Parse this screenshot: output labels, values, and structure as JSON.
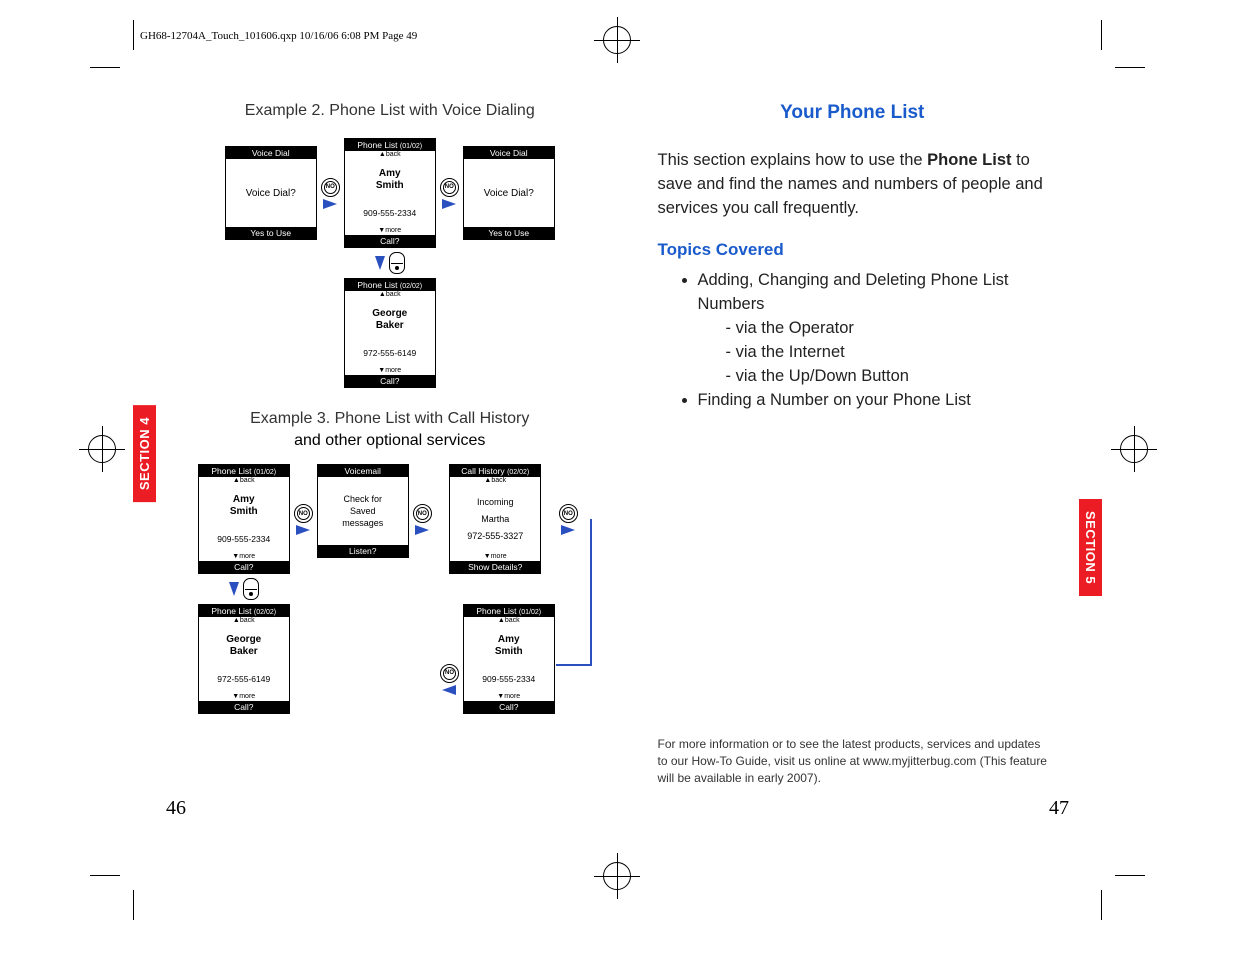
{
  "header_line": "GH68-12704A_Touch_101606.qxp  10/16/06  6:08 PM  Page 49",
  "left": {
    "section_tab": "SECTION 4",
    "page_number": "46",
    "example2_heading": "Example 2. Phone List with Voice Dialing",
    "example3_heading": "Example 3. Phone List with Call History",
    "example3_sub": "and other optional services"
  },
  "right": {
    "section_tab": "SECTION 5",
    "page_number": "47",
    "title": "Your Phone List",
    "intro_pre": "This section explains how to use the ",
    "intro_bold": "Phone List",
    "intro_post": " to save and find the names and numbers of people and services you call frequently.",
    "topics_label": "Topics Covered",
    "topics": {
      "item1": "Adding, Changing and Deleting Phone List Numbers",
      "sub1": "- via the Operator",
      "sub2": "- via the Internet",
      "sub3": "- via the Up/Down Button",
      "item2": "Finding a Number on your Phone List"
    },
    "footer": "For more information or to see the latest products, services and updates to our How-To Guide, visit us online at www.myjitterbug.com (This feature will be available in early 2007)."
  },
  "screens": {
    "no_label": "NO",
    "voice_dial": {
      "title": "Voice Dial",
      "body": "Voice Dial?",
      "footer": "Yes to Use"
    },
    "pl_amy": {
      "title": "Phone List",
      "count": "(01/02)",
      "back": "▲back",
      "name1": "Amy",
      "name2": "Smith",
      "num": "909-555-2334",
      "more": "▼more",
      "footer": "Call?"
    },
    "pl_george": {
      "title": "Phone List",
      "count": "(02/02)",
      "back": "▲back",
      "name1": "George",
      "name2": "Baker",
      "num": "972-555-6149",
      "more": "▼more",
      "footer": "Call?"
    },
    "voicemail": {
      "title": "Voicemail",
      "line1": "Check for",
      "line2": "Saved",
      "line3": "messages",
      "footer": "Listen?"
    },
    "callhist": {
      "title": "Call History",
      "count": "(02/02)",
      "back": "▲back",
      "line1": "Incoming",
      "line2": "Martha",
      "num": "972-555-3327",
      "more": "▼more",
      "footer": "Show Details?"
    }
  }
}
